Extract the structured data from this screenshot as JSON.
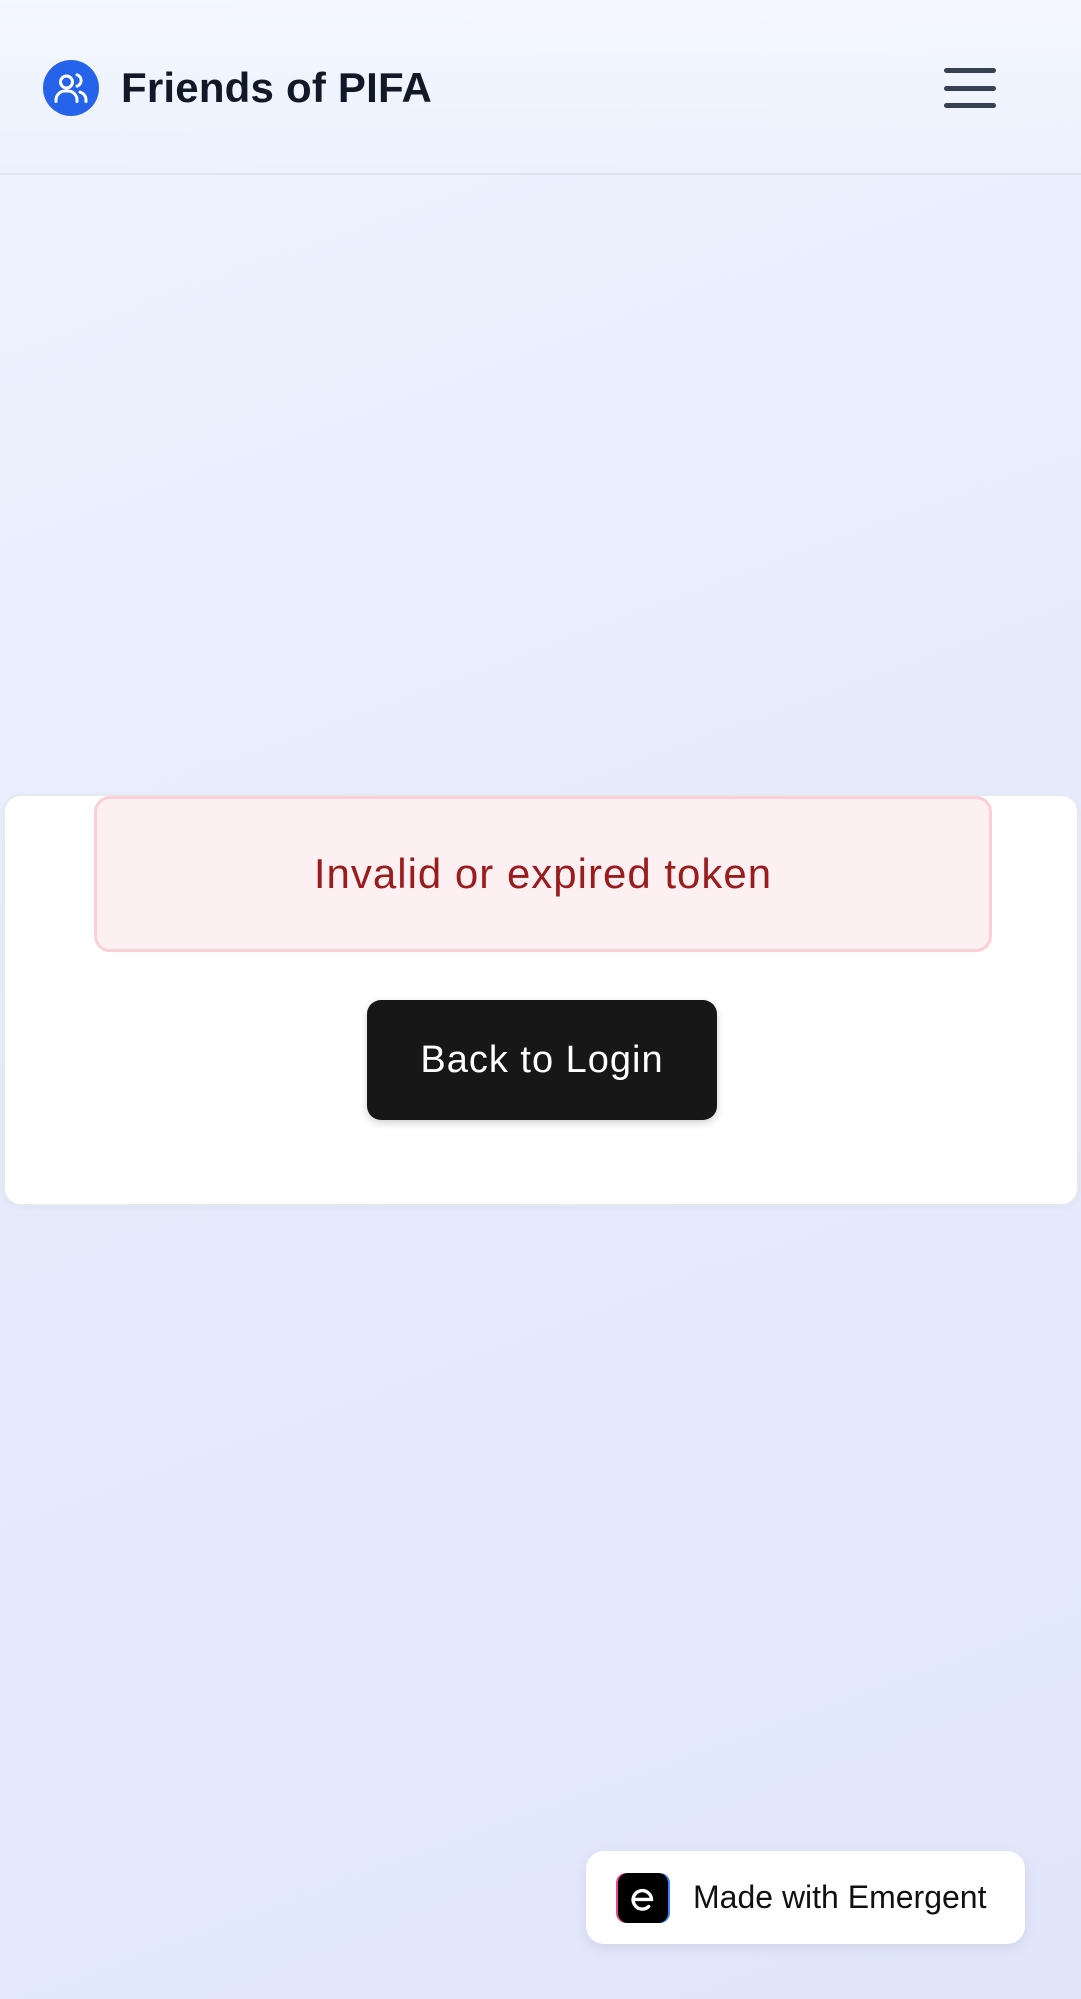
{
  "header": {
    "brand_icon": "users-icon",
    "title": "Friends of PIFA",
    "menu_icon": "hamburger-menu-icon"
  },
  "card": {
    "error_message": "Invalid or expired token",
    "back_button_label": "Back to Login"
  },
  "badge": {
    "logo_icon": "emergent-logo-icon",
    "label": "Made with Emergent"
  },
  "colors": {
    "brand_blue": "#2563eb",
    "error_text": "#9b1c1c",
    "error_bg": "#fdf0f2",
    "button_bg": "#171717"
  }
}
